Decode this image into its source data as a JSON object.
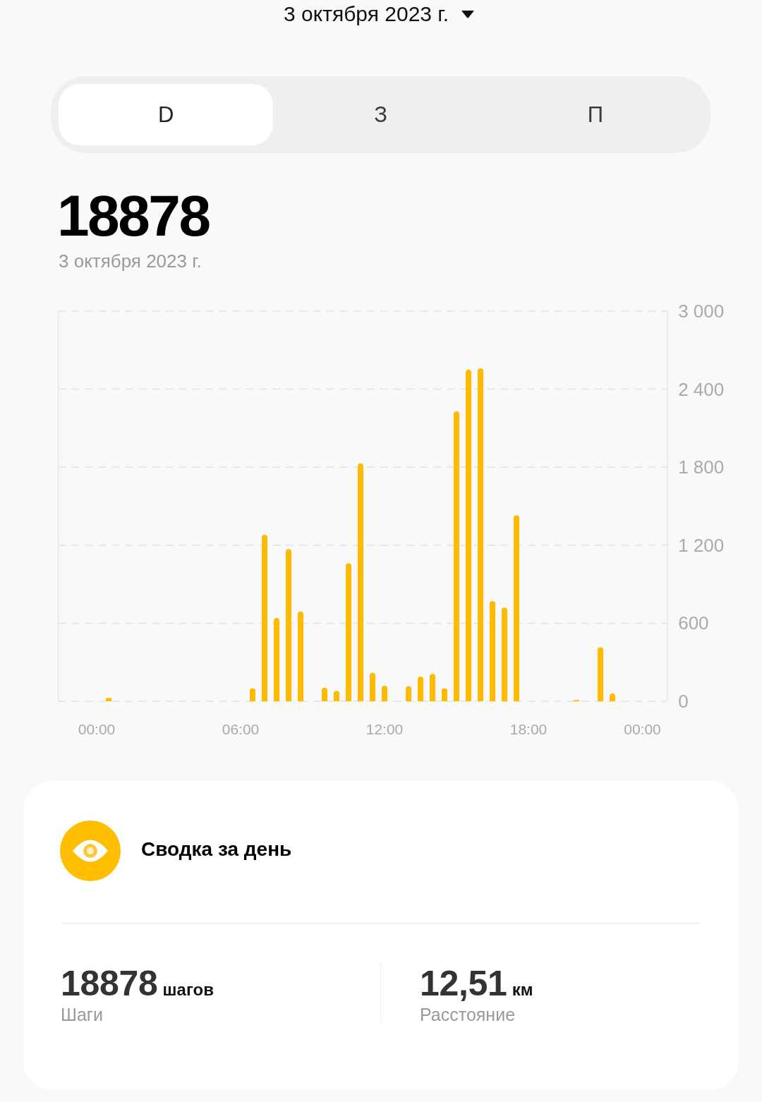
{
  "header": {
    "date": "3 октября 2023 г."
  },
  "tabs": [
    {
      "label": "D",
      "selected": true
    },
    {
      "label": "З",
      "selected": false
    },
    {
      "label": "П",
      "selected": false
    }
  ],
  "summary": {
    "total": "18878",
    "date": "3 октября 2023 г."
  },
  "chart": {
    "chart_data": {
      "type": "bar",
      "x": [
        0.5,
        6.5,
        7,
        7.5,
        8,
        8.5,
        9.5,
        10,
        10.5,
        11,
        11.5,
        12,
        13,
        13.5,
        14,
        14.5,
        15,
        15.5,
        16,
        16.5,
        17,
        17.5,
        20,
        21,
        21.5
      ],
      "values": [
        25,
        100,
        1280,
        640,
        1170,
        690,
        105,
        80,
        1060,
        1830,
        220,
        120,
        115,
        190,
        210,
        100,
        2230,
        2550,
        2560,
        770,
        720,
        1430,
        10,
        415,
        60
      ],
      "xlim": [
        -1.6,
        23.8
      ],
      "ylim": [
        0,
        3000
      ],
      "grid": true,
      "yticks": [
        {
          "value": 0,
          "label": "0"
        },
        {
          "value": 600,
          "label": "600"
        },
        {
          "value": 1200,
          "label": "1 200"
        },
        {
          "value": 1800,
          "label": "1 800"
        },
        {
          "value": 2400,
          "label": "2 400"
        },
        {
          "value": 3000,
          "label": "3 000"
        }
      ],
      "xticks": [
        {
          "value": 0,
          "label": "00:00"
        },
        {
          "value": 6,
          "label": "06:00"
        },
        {
          "value": 12,
          "label": "12:00"
        },
        {
          "value": 18,
          "label": "18:00"
        },
        {
          "value": 22.75,
          "label": "00:00"
        }
      ]
    }
  },
  "daily_card": {
    "title": "Сводка за день",
    "stats": [
      {
        "value": "18878",
        "unit": "шагов",
        "label": "Шаги"
      },
      {
        "value": "12,51",
        "unit": "км",
        "label": "Расстояние"
      }
    ]
  }
}
